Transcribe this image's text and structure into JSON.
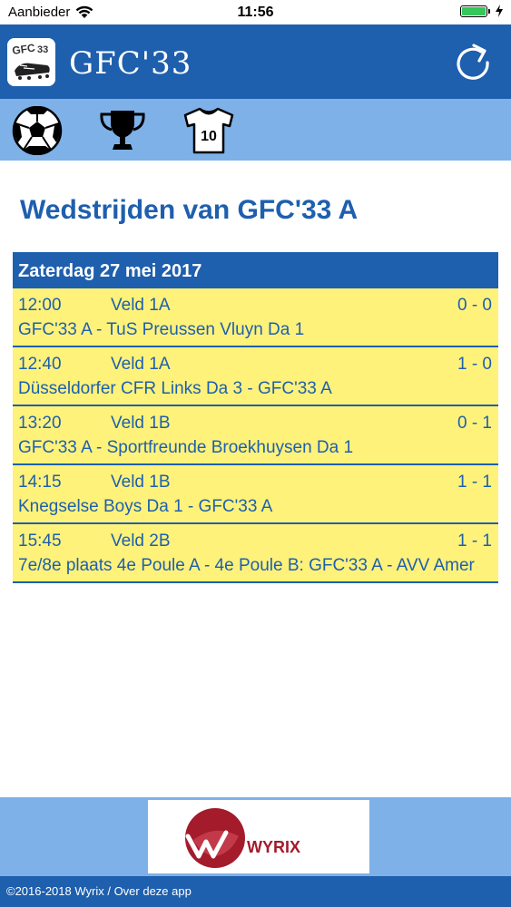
{
  "status_bar": {
    "carrier": "Aanbieder",
    "time": "11:56",
    "wifi_icon": "wifi-icon",
    "battery_icon": "battery-icon",
    "charging_icon": "charging-bolt-icon",
    "battery_level": 1.0
  },
  "app": {
    "title": "GFC'33",
    "logo_icon": "club-logo-icon",
    "refresh_icon": "refresh-icon"
  },
  "tabs": [
    {
      "icon": "soccer-ball-icon",
      "label": ""
    },
    {
      "icon": "trophy-icon",
      "label": ""
    },
    {
      "icon": "jersey-icon",
      "number": "10"
    }
  ],
  "page": {
    "heading": "Wedstrijden van GFC'33 A"
  },
  "schedule": {
    "date": "Zaterdag 27 mei 2017",
    "matches": [
      {
        "time": "12:00",
        "field": "Veld 1A",
        "score": "0 - 0",
        "teams": "GFC'33 A - TuS Preussen Vluyn Da 1"
      },
      {
        "time": "12:40",
        "field": "Veld 1A",
        "score": "1 - 0",
        "teams": "Düsseldorfer CFR Links Da 3 - GFC'33 A"
      },
      {
        "time": "13:20",
        "field": "Veld 1B",
        "score": "0 - 1",
        "teams": "GFC'33 A - Sportfreunde Broekhuysen Da 1"
      },
      {
        "time": "14:15",
        "field": "Veld 1B",
        "score": "1 - 1",
        "teams": "Knegselse Boys Da 1 - GFC'33 A"
      },
      {
        "time": "15:45",
        "field": "Veld 2B",
        "score": "1 - 1",
        "teams": "7e/8e plaats 4e Poule A - 4e Poule B: GFC'33 A - AVV Amer"
      }
    ]
  },
  "banner": {
    "logo_icon": "wyrix-logo-icon",
    "brand_text": "WYRIX"
  },
  "footer": {
    "text": "©2016-2018 Wyrix / Over deze app"
  },
  "colors": {
    "primary_blue": "#1e5fae",
    "light_blue": "#7eb1e8",
    "row_yellow": "#fef27a",
    "battery_green": "#35c759",
    "wyrix_red": "#a41b2b"
  }
}
